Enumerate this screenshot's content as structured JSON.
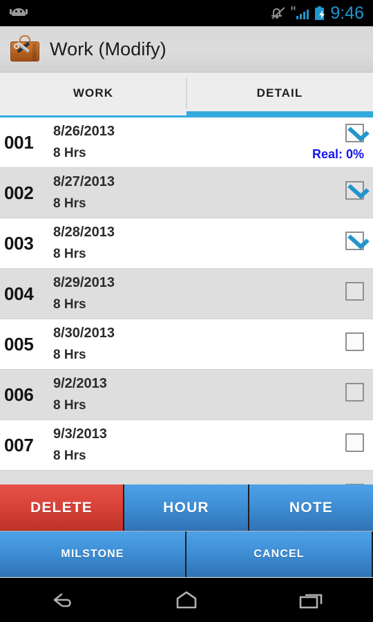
{
  "statusbar": {
    "notification_icon": "android-robot-icon",
    "icons": [
      "mute-icon",
      "signal-h-icon",
      "battery-charging-icon"
    ],
    "network_type": "H",
    "time": "9:46"
  },
  "actionbar": {
    "app_icon": "toolbox-icon",
    "title": "Work (Modify)"
  },
  "tabs": [
    {
      "label": "WORK",
      "active": false
    },
    {
      "label": "DETAIL",
      "active": true
    }
  ],
  "list": {
    "rows": [
      {
        "seq": "001",
        "date": "8/26/2013",
        "hours": "8 Hrs",
        "checked": true,
        "real": "Real: 0%"
      },
      {
        "seq": "002",
        "date": "8/27/2013",
        "hours": "8 Hrs",
        "checked": true,
        "real": ""
      },
      {
        "seq": "003",
        "date": "8/28/2013",
        "hours": "8 Hrs",
        "checked": true,
        "real": ""
      },
      {
        "seq": "004",
        "date": "8/29/2013",
        "hours": "8 Hrs",
        "checked": false,
        "real": ""
      },
      {
        "seq": "005",
        "date": "8/30/2013",
        "hours": "8 Hrs",
        "checked": false,
        "real": ""
      },
      {
        "seq": "006",
        "date": "9/2/2013",
        "hours": "8 Hrs",
        "checked": false,
        "real": ""
      },
      {
        "seq": "007",
        "date": "9/3/2013",
        "hours": "8 Hrs",
        "checked": false,
        "real": ""
      },
      {
        "seq": "",
        "date": "",
        "hours": "",
        "checked": false,
        "real": ""
      }
    ]
  },
  "buttons": {
    "row1": [
      {
        "label": "DELETE",
        "style": "danger"
      },
      {
        "label": "HOUR",
        "style": "primary"
      },
      {
        "label": "NOTE",
        "style": "primary"
      }
    ],
    "row2": [
      {
        "label": "MILSTONE",
        "style": "primary"
      },
      {
        "label": "CANCEL",
        "style": "primary"
      }
    ]
  },
  "navbar": {
    "back": "back-icon",
    "home": "home-icon",
    "recents": "recents-icon"
  },
  "colors": {
    "accent_blue": "#33aade",
    "button_blue": "#3f8fd6",
    "button_red": "#d94238",
    "real_text": "#1414f0",
    "row_alt": "#dedede"
  }
}
